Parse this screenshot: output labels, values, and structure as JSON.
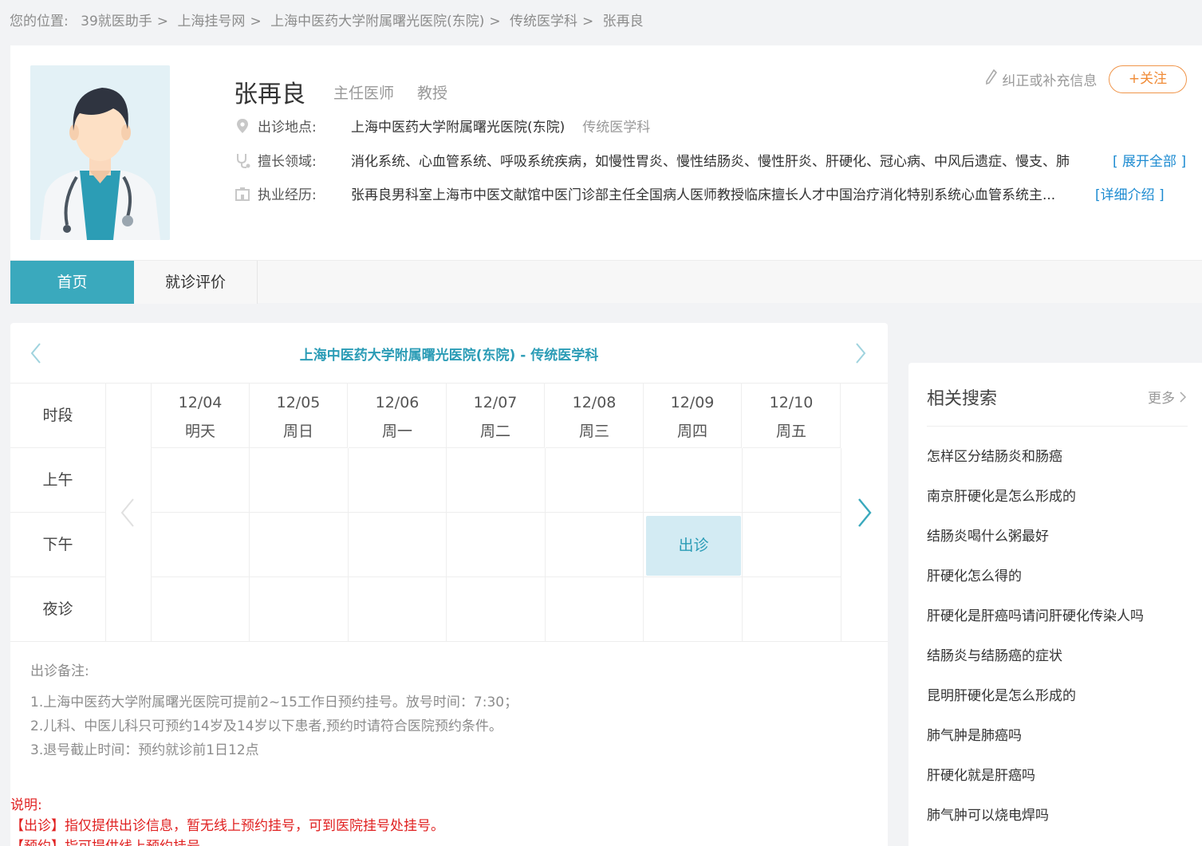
{
  "breadcrumb": {
    "label": "您的位置:",
    "items": [
      "39就医助手",
      "上海挂号网",
      "上海中医药大学附属曙光医院(东院)",
      "传统医学科",
      "张再良"
    ],
    "sep": ">"
  },
  "doctor": {
    "name": "张再良",
    "title": "主任医师",
    "rank": "教授",
    "location_label": "出诊地点:",
    "hospital": "上海中医药大学附属曙光医院(东院)",
    "department": "传统医学科",
    "specialty_label": "擅长领域:",
    "specialty": "消化系统、心血管系统、呼吸系统疾病，如慢性胃炎、慢性结肠炎、慢性肝炎、肝硬化、冠心病、中风后遗症、慢支、肺",
    "expand_label": "[ 展开全部 ]",
    "experience_label": "执业经历:",
    "experience": "张再良男科室上海市中医文献馆中医门诊部主任全国病人医师教授临床擅长人才中国治疗消化特别系统心血管系统主...",
    "detail_label": "[详细介绍 ]",
    "correct_label": "纠正或补充信息",
    "follow_label": "+关注"
  },
  "tabs": [
    {
      "label": "首页"
    },
    {
      "label": "就诊评价"
    }
  ],
  "schedule": {
    "title": "上海中医药大学附属曙光医院(东院) - 传统医学科",
    "period_header": "时段",
    "rows": [
      "上午",
      "下午",
      "夜诊"
    ],
    "days": [
      {
        "date": "12/04",
        "weekday": "明天"
      },
      {
        "date": "12/05",
        "weekday": "周日"
      },
      {
        "date": "12/06",
        "weekday": "周一"
      },
      {
        "date": "12/07",
        "weekday": "周二"
      },
      {
        "date": "12/08",
        "weekday": "周三"
      },
      {
        "date": "12/09",
        "weekday": "周四"
      },
      {
        "date": "12/10",
        "weekday": "周五"
      }
    ],
    "slot": {
      "day_index": 5,
      "row_index": 1,
      "label": "出诊"
    }
  },
  "notes": {
    "header": "出诊备注:",
    "lines": [
      "1.上海中医药大学附属曙光医院可提前2~15工作日预约挂号。放号时间：7:30；",
      "2.儿科、中医儿科只可预约14岁及14岁以下患者,预约时请符合医院预约条件。",
      "3.退号截止时间：预约就诊前1日12点"
    ]
  },
  "explain": {
    "header": "说明:",
    "lines": [
      "【出诊】指仅提供出诊信息，暂无线上预约挂号，可到医院挂号处挂号。",
      "【预约】指可提供线上预约挂号"
    ]
  },
  "related": {
    "title": "相关搜索",
    "more": "更多",
    "items": [
      "怎样区分结肠炎和肠癌",
      "南京肝硬化是怎么形成的",
      "结肠炎喝什么粥最好",
      "肝硬化怎么得的",
      "肝硬化是肝癌吗请问肝硬化传染人吗",
      "结肠炎与结肠癌的症状",
      "昆明肝硬化是怎么形成的",
      "肺气肿是肺癌吗",
      "肝硬化就是肝癌吗",
      "肺气肿可以烧电焊吗"
    ]
  },
  "colors": {
    "accent": "#3aa9bd",
    "follow": "#f08a35",
    "link": "#1d8bd1",
    "warning": "#e02020"
  }
}
